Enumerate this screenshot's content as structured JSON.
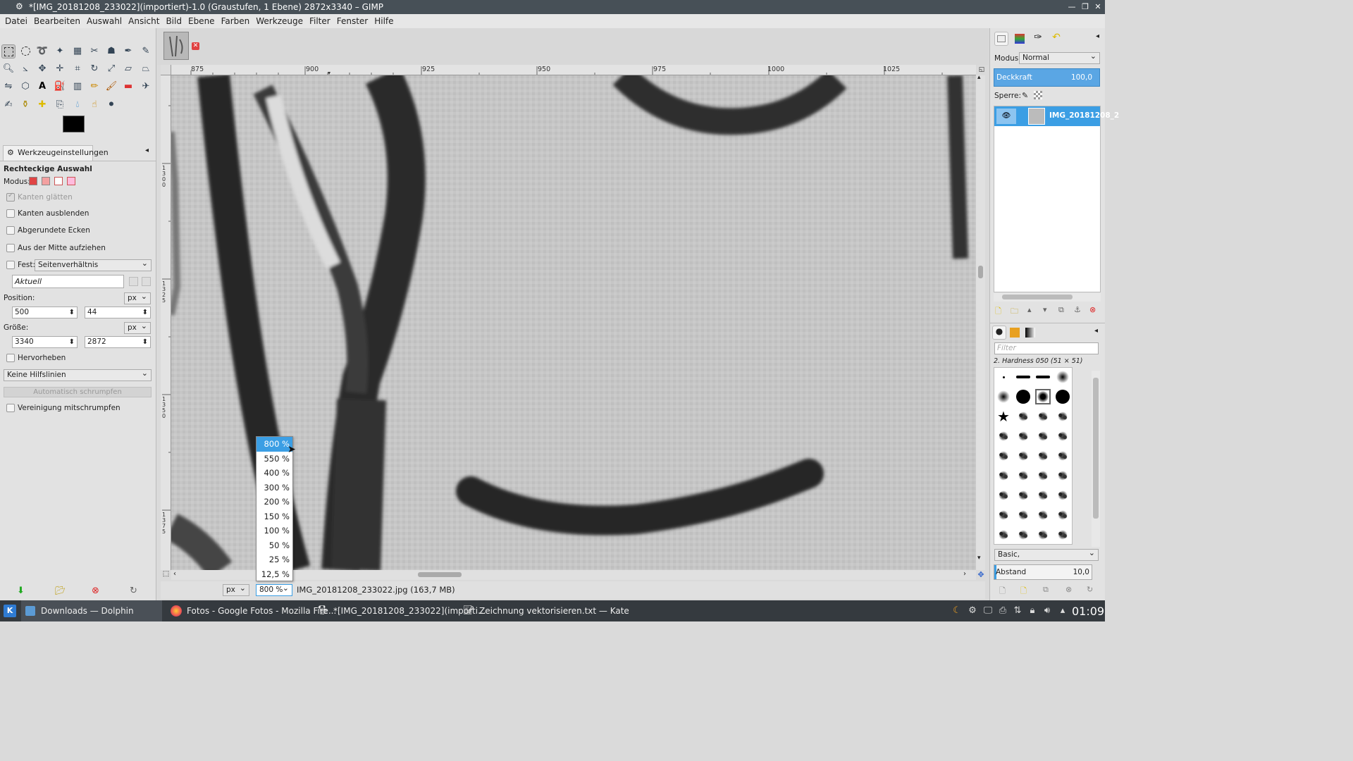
{
  "window": {
    "title": "*[IMG_20181208_233022](importiert)-1.0 (Graustufen, 1 Ebene) 2872x3340 – GIMP"
  },
  "menu": [
    "Datei",
    "Bearbeiten",
    "Auswahl",
    "Ansicht",
    "Bild",
    "Ebene",
    "Farben",
    "Werkzeuge",
    "Filter",
    "Fenster",
    "Hilfe"
  ],
  "tool_options": {
    "tab_label": "Werkzeugeinstellungen",
    "tool_name": "Rechteckige Auswahl",
    "mode_label": "Modus:",
    "antialias": "Kanten glätten",
    "feather": "Kanten ausblenden",
    "rounded": "Abgerundete Ecken",
    "from_center": "Aus der Mitte aufziehen",
    "fixed_label": "Fest:",
    "fixed_value": "Seitenverhältnis",
    "current_value": "Aktuell",
    "position_label": "Position:",
    "position_unit": "px",
    "position_x": "500",
    "position_y": "44",
    "size_label": "Größe:",
    "size_unit": "px",
    "size_w": "3340",
    "size_h": "2872",
    "highlight": "Hervorheben",
    "guides_value": "Keine Hilfslinien",
    "autoshrink": "Automatisch schrumpfen",
    "shrink_merged": "Vereinigung mitschrumpfen"
  },
  "ruler": {
    "h_ticks": [
      "875",
      "900",
      "925",
      "950",
      "975",
      "1000",
      "1025"
    ],
    "v_ticks": [
      "1300",
      "1325",
      "1350",
      "1375"
    ]
  },
  "zoom_menu": {
    "items": [
      "800 %",
      "550 %",
      "400 %",
      "300 %",
      "200 %",
      "150 %",
      "100 %",
      "50 %",
      "25 %",
      "12,5 %"
    ],
    "selected": "800 %"
  },
  "statusbar": {
    "unit": "px",
    "zoom": "800 %",
    "info": "IMG_20181208_233022.jpg (163,7 MB)"
  },
  "layers": {
    "mode_label": "Modus:",
    "mode_value": "Normal",
    "opacity_label": "Deckkraft",
    "opacity_value": "100,0",
    "lock_label": "Sperre:",
    "layer_name": "IMG_20181208_2"
  },
  "brushes": {
    "filter_placeholder": "Filter",
    "current_brush": "2. Hardness 050 (51 × 51)",
    "preset": "Basic,",
    "spacing_label": "Abstand",
    "spacing_value": "10,0"
  },
  "taskbar": {
    "tasks": [
      "Downloads — Dolphin",
      "Fotos - Google Fotos - Mozilla Fire...",
      "*[IMG_20181208_233022](importi...",
      "Zeichnung vektorisieren.txt — Kate"
    ],
    "clock": "01:09"
  }
}
